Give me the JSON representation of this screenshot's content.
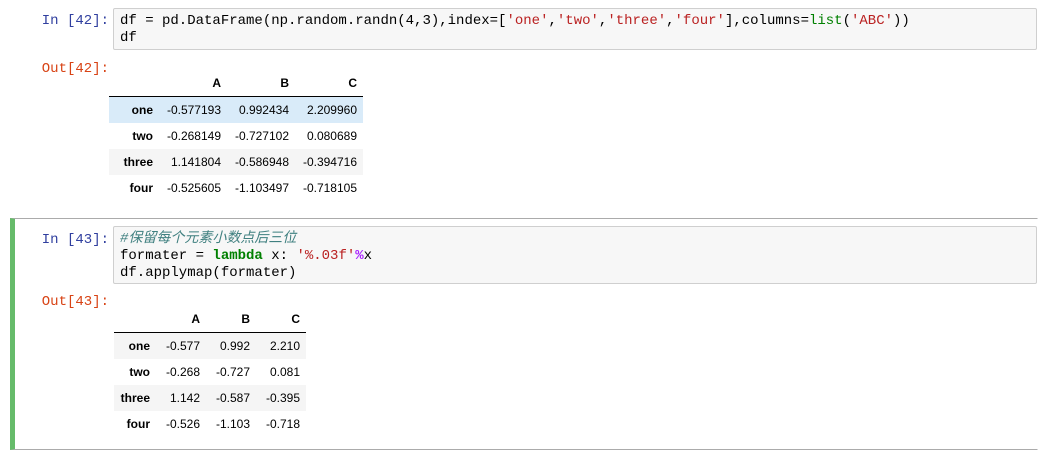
{
  "cells": [
    {
      "in_prompt": "In [42]:",
      "out_prompt": "Out[42]:",
      "code_line1_a": "df = pd.DataFrame(np.random.randn(4,3),index=[",
      "code_line1_s1": "'one'",
      "code_line1_c1": ",",
      "code_line1_s2": "'two'",
      "code_line1_c2": ",",
      "code_line1_s3": "'three'",
      "code_line1_c3": ",",
      "code_line1_s4": "'four'",
      "code_line1_c4": "],columns=",
      "code_line1_b": "list",
      "code_line1_c5": "(",
      "code_line1_s5": "'ABC'",
      "code_line1_c6": "))",
      "code_line2": "df",
      "table": {
        "columns": [
          "A",
          "B",
          "C"
        ],
        "rows": [
          {
            "index": "one",
            "values": [
              "-0.577193",
              "0.992434",
              "2.209960"
            ]
          },
          {
            "index": "two",
            "values": [
              "-0.268149",
              "-0.727102",
              "0.080689"
            ]
          },
          {
            "index": "three",
            "values": [
              "1.141804",
              "-0.586948",
              "-0.394716"
            ]
          },
          {
            "index": "four",
            "values": [
              "-0.525605",
              "-1.103497",
              "-0.718105"
            ]
          }
        ]
      }
    },
    {
      "in_prompt": "In [43]:",
      "out_prompt": "Out[43]:",
      "comment": "#保留每个元素小数点后三位",
      "line2_a": "formater = ",
      "line2_kw": "lambda",
      "line2_b": " x: ",
      "line2_str": "'%.03f'",
      "line2_op": "%",
      "line2_c": "x",
      "line3": "df.applymap(formater)",
      "table": {
        "columns": [
          "A",
          "B",
          "C"
        ],
        "rows": [
          {
            "index": "one",
            "values": [
              "-0.577",
              "0.992",
              "2.210"
            ]
          },
          {
            "index": "two",
            "values": [
              "-0.268",
              "-0.727",
              "0.081"
            ]
          },
          {
            "index": "three",
            "values": [
              "1.142",
              "-0.587",
              "-0.395"
            ]
          },
          {
            "index": "four",
            "values": [
              "-0.526",
              "-1.103",
              "-0.718"
            ]
          }
        ]
      }
    }
  ]
}
